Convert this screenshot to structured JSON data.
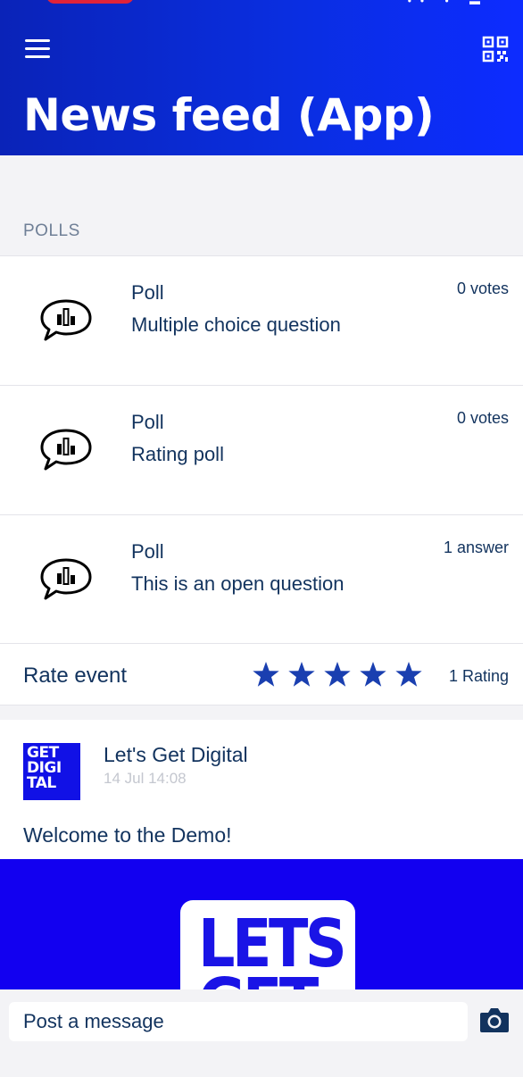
{
  "header": {
    "title": "News feed (App)",
    "status_glyphs": "•• • ▬"
  },
  "polls": {
    "section_label": "POLLS",
    "items": [
      {
        "type": "Poll",
        "title": "Multiple choice question",
        "count": "0 votes"
      },
      {
        "type": "Poll",
        "title": "Rating poll",
        "count": "0 votes"
      },
      {
        "type": "Poll",
        "title": "This is an open question",
        "count": "1 answer"
      }
    ]
  },
  "rating": {
    "label": "Rate event",
    "stars": 5,
    "count": "1 Rating"
  },
  "post": {
    "avatar_text": "GET DIGI TAL",
    "author": "Let's Get Digital",
    "time": "14 Jul 14:08",
    "text": "Welcome to the Demo!",
    "image_text": "LETS\nGET"
  },
  "composer": {
    "placeholder": "Post a message"
  },
  "colors": {
    "header_blue": "#0a2ee0",
    "star_blue": "#1a3fb0",
    "text_navy": "#12335e"
  }
}
